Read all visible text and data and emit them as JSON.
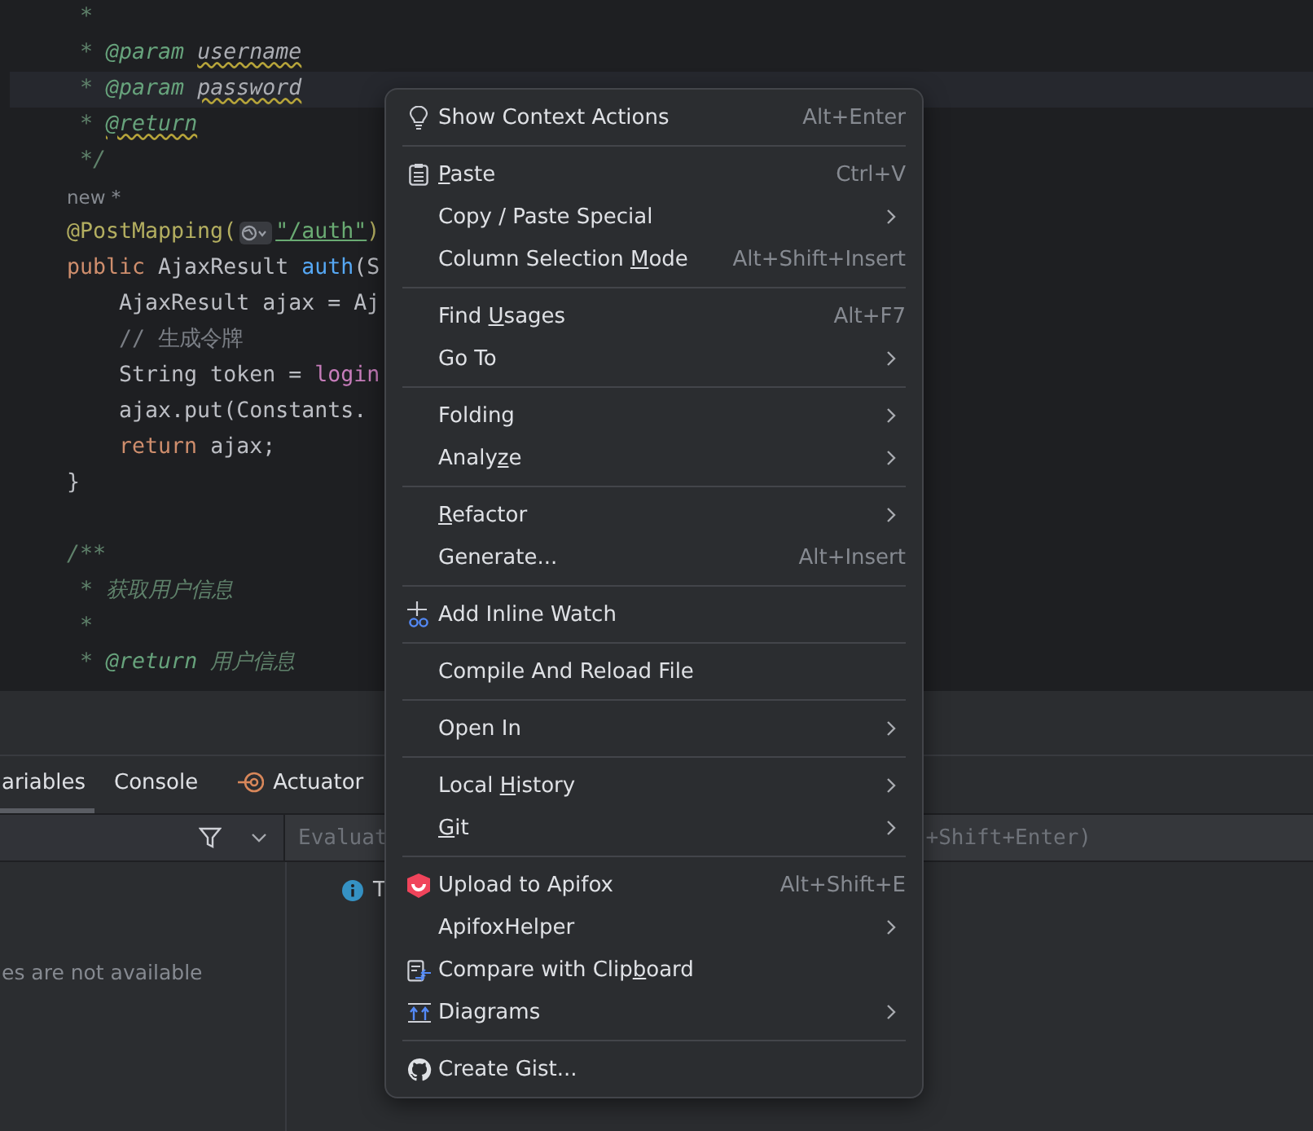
{
  "editor": {
    "lines": [
      {
        "tokens": [
          {
            "text": " *",
            "kind": "doc"
          }
        ]
      },
      {
        "tokens": [
          {
            "text": " * ",
            "kind": "doc"
          },
          {
            "text": "@param",
            "kind": "tag"
          },
          {
            "text": "username",
            "kind": "ref"
          }
        ]
      },
      {
        "current": true,
        "tokens": [
          {
            "text": " * ",
            "kind": "doc"
          },
          {
            "text": "@param",
            "kind": "tag"
          },
          {
            "text": "password",
            "kind": "ref"
          }
        ]
      },
      {
        "tokens": [
          {
            "text": " * ",
            "kind": "doc"
          },
          {
            "text": "@return",
            "kind": "tagwarn"
          }
        ]
      },
      {
        "tokens": [
          {
            "text": " */",
            "kind": "doc"
          }
        ]
      },
      {
        "tokens": [
          {
            "text": "new *",
            "kind": "hint"
          }
        ]
      },
      {
        "tokens": [
          {
            "text": "@PostMapping(",
            "kind": "annotation"
          },
          {
            "kind": "inlay"
          },
          {
            "text": "\"/auth\"",
            "kind": "string"
          },
          {
            "text": ")",
            "kind": "annotation"
          }
        ]
      },
      {
        "tokens": [
          {
            "text": "public ",
            "kind": "keyword"
          },
          {
            "text": "AjaxResult ",
            "kind": "plain"
          },
          {
            "text": "auth",
            "kind": "method"
          },
          {
            "text": "(S",
            "kind": "plain"
          }
        ]
      },
      {
        "tokens": [
          {
            "text": "    AjaxResult ajax = Aj",
            "kind": "plain"
          }
        ]
      },
      {
        "tokens": [
          {
            "text": "    // 生成令牌",
            "kind": "comment"
          }
        ]
      },
      {
        "tokens": [
          {
            "text": "    String token = ",
            "kind": "plain"
          },
          {
            "text": "login",
            "kind": "field"
          }
        ]
      },
      {
        "tokens": [
          {
            "text": "    ajax.put(Constants.",
            "kind": "plain"
          }
        ]
      },
      {
        "tokens": [
          {
            "text": "    return ",
            "kind": "keyword"
          },
          {
            "text": "ajax;",
            "kind": "plain"
          }
        ]
      },
      {
        "tokens": [
          {
            "text": "}",
            "kind": "plain"
          }
        ]
      },
      {
        "kind": "blank"
      },
      {
        "tokens": [
          {
            "text": "/**",
            "kind": "doc"
          }
        ]
      },
      {
        "tokens": [
          {
            "text": " * ",
            "kind": "doc"
          },
          {
            "text": "获取用户信息",
            "kind": "docitalic"
          }
        ]
      },
      {
        "tokens": [
          {
            "text": " *",
            "kind": "doc"
          }
        ]
      },
      {
        "tokens": [
          {
            "text": " * ",
            "kind": "doc"
          },
          {
            "text": "@return",
            "kind": "tag"
          },
          {
            "text": "用户信息",
            "kind": "docnote"
          }
        ]
      }
    ]
  },
  "debug_panel": {
    "tabs": [
      {
        "label": "ariables",
        "selected": true,
        "kind": "plain"
      },
      {
        "label": "Console",
        "selected": false,
        "kind": "plain"
      },
      {
        "label": "Actuator",
        "selected": false,
        "kind": "actuator"
      }
    ],
    "evaluate_placeholder_left": "Evaluat",
    "evaluate_placeholder_right": "+Shift+Enter)",
    "info_text": "T",
    "empty_text": "es are not available"
  },
  "context_menu": {
    "groups": [
      {
        "items": [
          {
            "kind": "bulb",
            "label": "Show Context Actions",
            "shortcut": "Alt+Enter",
            "submenu": false
          }
        ]
      },
      {
        "items": [
          {
            "kind": "clipboard",
            "label_parts": {
              "key": "P",
              "after": "aste"
            },
            "shortcut": "Ctrl+V",
            "submenu": false
          },
          {
            "kind": "plain",
            "label": "Copy / Paste Special",
            "submenu": true
          },
          {
            "kind": "plain",
            "label_parts": {
              "before": "Column Selection ",
              "key": "M",
              "after": "ode"
            },
            "shortcut": "Alt+Shift+Insert",
            "submenu": false
          }
        ]
      },
      {
        "items": [
          {
            "kind": "plain",
            "label_parts": {
              "before": "Find ",
              "key": "U",
              "after": "sages"
            },
            "shortcut": "Alt+F7",
            "submenu": false
          },
          {
            "kind": "plain",
            "label": "Go To",
            "submenu": true
          }
        ]
      },
      {
        "items": [
          {
            "kind": "plain",
            "label": "Folding",
            "submenu": true
          },
          {
            "kind": "plain",
            "label_parts": {
              "before": "Analy",
              "key": "z",
              "after": "e"
            },
            "submenu": true
          }
        ]
      },
      {
        "items": [
          {
            "kind": "plain",
            "label_parts": {
              "key": "R",
              "after": "efactor"
            },
            "submenu": true
          },
          {
            "kind": "plain",
            "label": "Generate...",
            "shortcut": "Alt+Insert",
            "submenu": false
          }
        ]
      },
      {
        "items": [
          {
            "kind": "watch",
            "label": "Add Inline Watch",
            "submenu": false
          }
        ]
      },
      {
        "items": [
          {
            "kind": "plain",
            "label": "Compile And Reload File",
            "submenu": false
          }
        ]
      },
      {
        "items": [
          {
            "kind": "plain",
            "label": "Open In",
            "submenu": true
          }
        ]
      },
      {
        "items": [
          {
            "kind": "plain",
            "label_parts": {
              "before": "Local ",
              "key": "H",
              "after": "istory"
            },
            "submenu": true
          },
          {
            "kind": "plain",
            "label_parts": {
              "key": "G",
              "after": "it"
            },
            "submenu": true
          }
        ]
      },
      {
        "items": [
          {
            "kind": "apifox",
            "label": "Upload to Apifox",
            "shortcut": "Alt+Shift+E",
            "submenu": false
          },
          {
            "kind": "plain",
            "label": "ApifoxHelper",
            "submenu": true
          },
          {
            "kind": "compare",
            "label_parts": {
              "before": "Compare with Clip",
              "key": "b",
              "after": "oard"
            },
            "submenu": false
          },
          {
            "kind": "diagrams",
            "label": "Diagrams",
            "submenu": true
          }
        ]
      },
      {
        "items": [
          {
            "kind": "github",
            "label": "Create Gist...",
            "submenu": false
          }
        ]
      }
    ]
  }
}
